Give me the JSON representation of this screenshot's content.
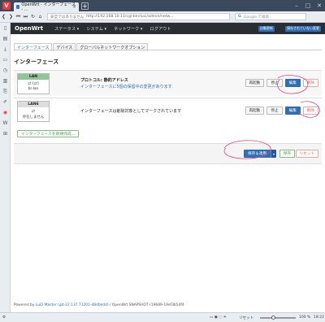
{
  "browser": {
    "tab_title": "OpenWrt - インターフェース - ...",
    "url_secure": "安全ではありません",
    "url": "http://192.168.10.11/cgi-bin/luci/admin/netw...",
    "search_placeholder": "Google で検索",
    "status_zoom": "100 %",
    "status_time": "18:22",
    "status_reset": "リセット"
  },
  "header": {
    "brand": "OpenWrt",
    "menu": [
      "ステータス ▾",
      "システム ▾",
      "ネットワーク ▾",
      "ログアウト"
    ],
    "badge_refresh": "自動更新",
    "badge_changes": "保存されていない変更"
  },
  "subtabs": [
    "インターフェース",
    "デバイス",
    "グローバルネットワークオプション"
  ],
  "section_title": "インターフェース",
  "interfaces": [
    {
      "name": "LAN",
      "symbol": "⇄ (⇄)",
      "device": "br-lan",
      "protocol": "プロトコル: 静的アドレス",
      "changes": "インターフェースに5個の保留中の変更があります",
      "buttons": {
        "restart": "再起動",
        "stop": "停止",
        "edit": "編集",
        "delete": "削除"
      }
    },
    {
      "name": "LAN6",
      "symbol": "⇄",
      "device": "存在しません",
      "info": "インターフェースは削除対象としてマークされています",
      "buttons": {
        "restart": "再起動",
        "stop": "停止",
        "edit": "編集",
        "delete": "削除"
      }
    }
  ],
  "add_button": "インターフェースを新規作成...",
  "actions": {
    "save_apply": "保存＆適用",
    "save": "保存",
    "reset": "リセット"
  },
  "footer": {
    "prefix": "Powered by ",
    "luci_link": "LuCI Master (git-22.137.71201-d8dbedd)",
    "suffix": " / OpenWrt SNAPSHOT r19689-19ef3b54f4"
  },
  "colors": {
    "header_bg": "#2a2d31",
    "primary": "#2f6db5",
    "success": "#4a9b4a",
    "danger": "#d9534f",
    "lan_head": "#90c695"
  }
}
